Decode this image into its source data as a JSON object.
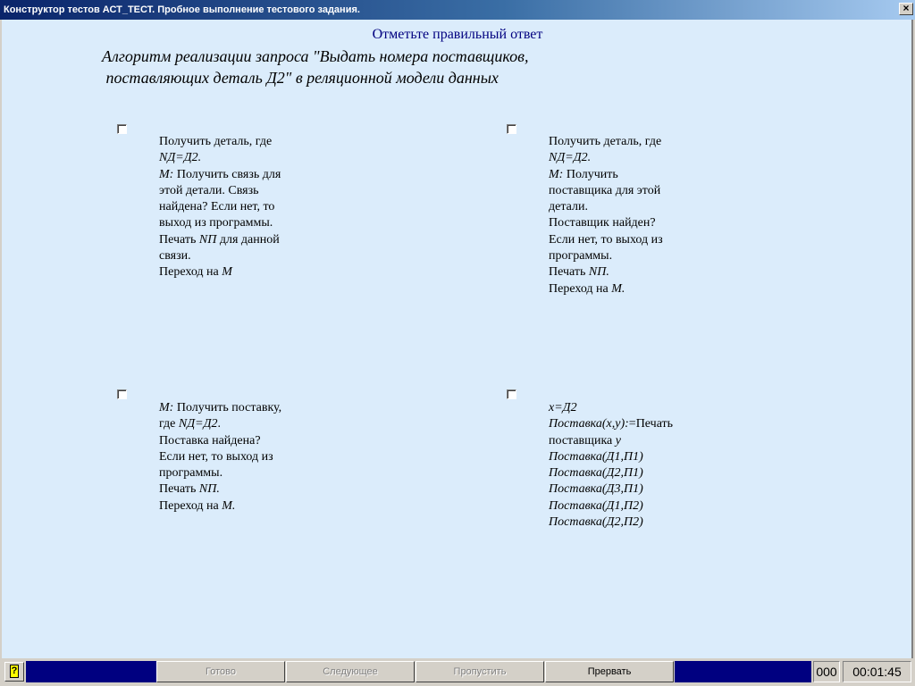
{
  "window": {
    "title": "Конструктор тестов АСТ_ТЕСТ. Пробное выполнение тестового задания.",
    "close_label": "×"
  },
  "header": "Отметьте правильный ответ",
  "question": "Алгоритм реализации запроса \"Выдать номера поставщиков,\n поставляющих деталь Д2\" в реляционной модели данных",
  "answers": [
    {
      "lines": [
        [
          {
            "t": "Получить деталь, где"
          }
        ],
        [
          {
            "t": "NД=Д2.",
            "i": true
          }
        ],
        [
          {
            "t": "М:",
            "i": true
          },
          {
            "t": " Получить связь для"
          }
        ],
        [
          {
            "t": "этой детали. Связь"
          }
        ],
        [
          {
            "t": "найдена? Если нет, то"
          }
        ],
        [
          {
            "t": "выход из программы."
          }
        ],
        [
          {
            "t": "Печать "
          },
          {
            "t": "NП",
            "i": true
          },
          {
            "t": " для данной"
          }
        ],
        [
          {
            "t": "связи."
          }
        ],
        [
          {
            "t": "Переход на "
          },
          {
            "t": "М",
            "i": true
          }
        ]
      ]
    },
    {
      "lines": [
        [
          {
            "t": "Получить деталь, где"
          }
        ],
        [
          {
            "t": "NД=Д2.",
            "i": true
          }
        ],
        [
          {
            "t": "М:",
            "i": true
          },
          {
            "t": " Получить"
          }
        ],
        [
          {
            "t": "поставщика для этой"
          }
        ],
        [
          {
            "t": "детали."
          }
        ],
        [
          {
            "t": "Поставщик найден?"
          }
        ],
        [
          {
            "t": "Если нет, то выход из"
          }
        ],
        [
          {
            "t": "программы."
          }
        ],
        [
          {
            "t": "Печать "
          },
          {
            "t": "NП.",
            "i": true
          }
        ],
        [
          {
            "t": "Переход на "
          },
          {
            "t": "М.",
            "i": true
          }
        ]
      ]
    },
    {
      "lines": [
        [
          {
            "t": "М:",
            "i": true
          },
          {
            "t": " Получить поставку,"
          }
        ],
        [
          {
            "t": "где "
          },
          {
            "t": "NД=Д2",
            "i": true
          },
          {
            "t": "."
          }
        ],
        [
          {
            "t": "Поставка найдена?"
          }
        ],
        [
          {
            "t": "Если нет, то выход из"
          }
        ],
        [
          {
            "t": "программы."
          }
        ],
        [
          {
            "t": "Печать "
          },
          {
            "t": "NП.",
            "i": true
          }
        ],
        [
          {
            "t": "Переход на "
          },
          {
            "t": "М.",
            "i": true
          }
        ]
      ]
    },
    {
      "lines": [
        [
          {
            "t": "x=Д2",
            "i": true
          }
        ],
        [
          {
            "t": "Поставка(x,y):",
            "i": true
          },
          {
            "t": "=Печать"
          }
        ],
        [
          {
            "t": "поставщика "
          },
          {
            "t": "y",
            "i": true
          }
        ],
        [
          {
            "t": "Поставка(Д1,П1)",
            "i": true
          }
        ],
        [
          {
            "t": "Поставка(Д2,П1)",
            "i": true
          }
        ],
        [
          {
            "t": "Поставка(Д3,П1)",
            "i": true
          }
        ],
        [
          {
            "t": "Поставка(Д1,П2)",
            "i": true
          }
        ],
        [
          {
            "t": "Поставка(Д2,П2)",
            "i": true
          }
        ]
      ]
    }
  ],
  "buttons": {
    "done": "Готово",
    "next": "Следующее",
    "skip": "Пропустить",
    "abort": "Прервать"
  },
  "status": {
    "help_icon": "help-icon",
    "help_glyph": "?",
    "counter": "000",
    "timer": "00:01:45"
  }
}
